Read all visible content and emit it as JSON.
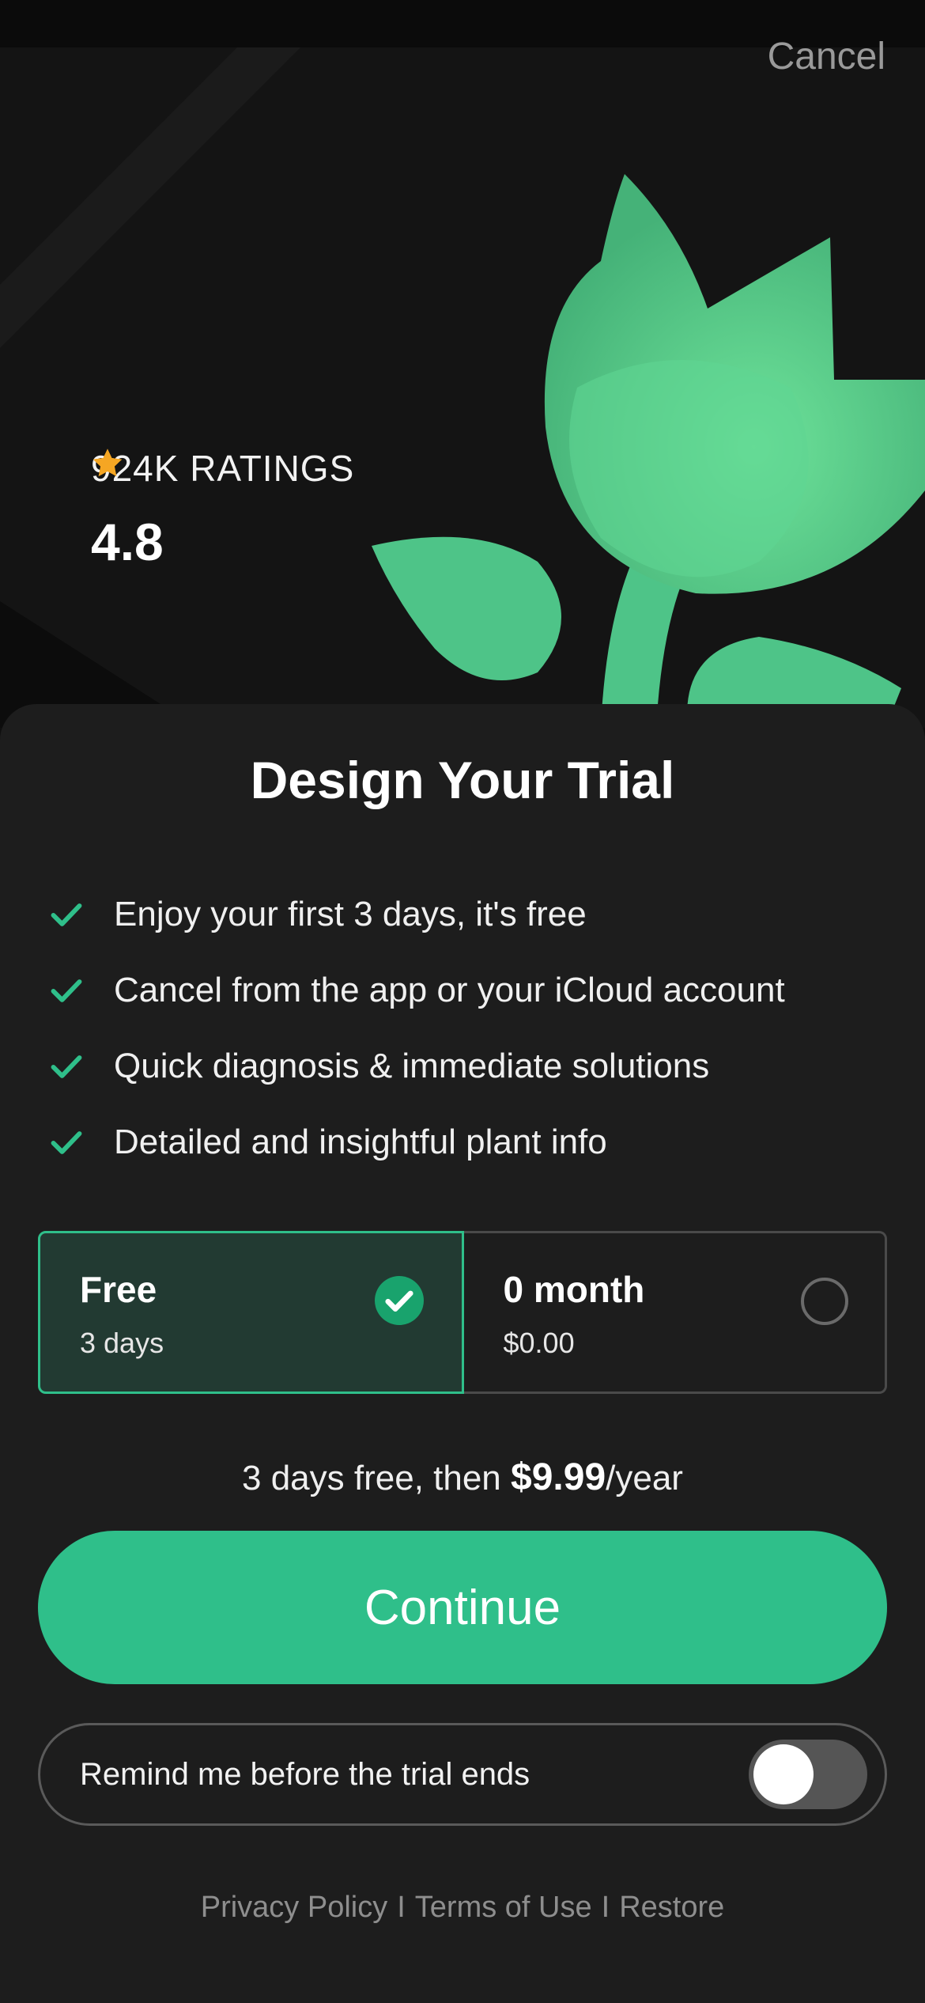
{
  "header": {
    "cancel_label": "Cancel"
  },
  "hero": {
    "ratings_count": "924K RATINGS",
    "rating_value": "4.8",
    "stars": 5,
    "star_color": "#f5a623",
    "leaf_color": "#4ecb8a"
  },
  "trial": {
    "title": "Design Your Trial",
    "features": [
      "Enjoy your first 3 days, it's free",
      "Cancel from the app or your iCloud account",
      "Quick diagnosis & immediate solutions",
      "Detailed and insightful plant info"
    ],
    "plans": [
      {
        "name": "Free",
        "sub": "3 days",
        "selected": true
      },
      {
        "name": "0 month",
        "sub": "$0.00",
        "selected": false
      }
    ],
    "price_prefix": "3 days free, then ",
    "price_amount": "$9.99",
    "price_suffix": "/year",
    "continue_label": "Continue",
    "remind_label": "Remind me before the trial ends",
    "remind_enabled": false
  },
  "footer": {
    "privacy": "Privacy Policy",
    "terms": "Terms of Use",
    "restore": "Restore",
    "separator": "I"
  },
  "colors": {
    "accent": "#2fbf8a",
    "sheet_bg": "#1d1d1d"
  }
}
